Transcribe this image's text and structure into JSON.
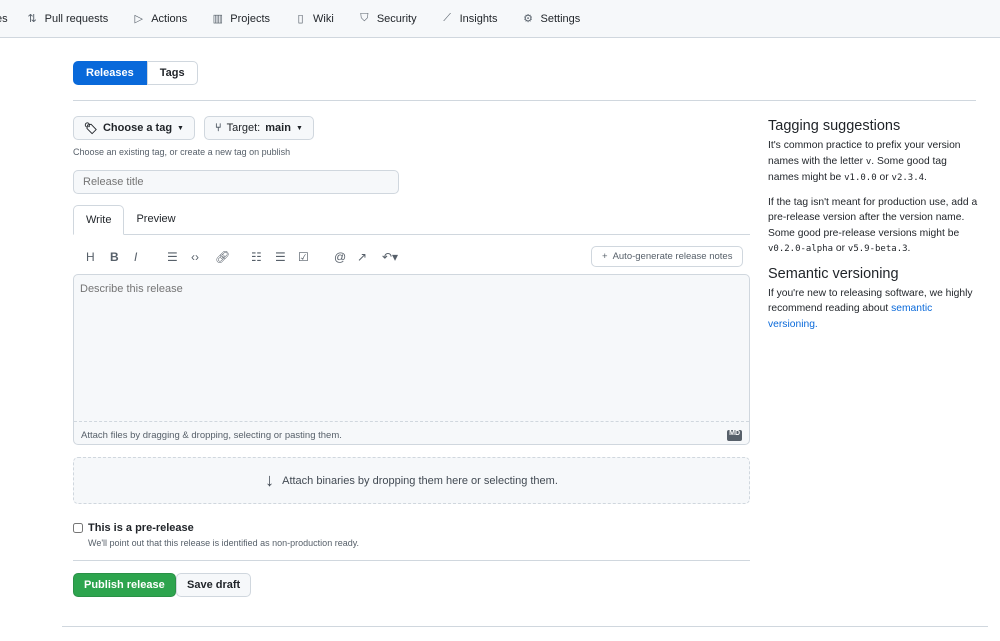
{
  "nav": [
    {
      "label": "es",
      "icon": ""
    },
    {
      "label": "Pull requests",
      "icon": "pull-request-icon"
    },
    {
      "label": "Actions",
      "icon": "play-icon"
    },
    {
      "label": "Projects",
      "icon": "project-icon"
    },
    {
      "label": "Wiki",
      "icon": "book-icon"
    },
    {
      "label": "Security",
      "icon": "shield-icon"
    },
    {
      "label": "Insights",
      "icon": "graph-icon"
    },
    {
      "label": "Settings",
      "icon": "gear-icon"
    }
  ],
  "seg": {
    "releases": "Releases",
    "tags": "Tags"
  },
  "form": {
    "choose_tag": "Choose a tag",
    "target_label": "Target:",
    "target_value": "main",
    "tag_hint": "Choose an existing tag, or create a new tag on publish",
    "title_placeholder": "Release title",
    "tab_write": "Write",
    "tab_preview": "Preview",
    "auto_generate": "Auto-generate release notes",
    "body_placeholder": "Describe this release",
    "attach_files": "Attach files by dragging & dropping, selecting or pasting them.",
    "markdown_badge": "MD",
    "attach_binaries": "Attach binaries by dropping them here or selecting them.",
    "prerelease_label": "This is a pre-release",
    "prerelease_hint": "We'll point out that this release is identified as non-production ready.",
    "publish": "Publish release",
    "save_draft": "Save draft"
  },
  "side": {
    "h1": "Tagging suggestions",
    "p1a": "It's common practice to prefix your version names with the letter ",
    "p1code1": "v",
    "p1b": ". Some good tag names might be ",
    "p1code2": "v1.0.0",
    "p1c": " or ",
    "p1code3": "v2.3.4",
    "p1d": ".",
    "p2a": "If the tag isn't meant for production use, add a pre-release version after the version name. Some good pre-release versions might be ",
    "p2code1": "v0.2.0-alpha",
    "p2b": " or ",
    "p2code2": "v5.9-beta.3",
    "p2c": ".",
    "h2": "Semantic versioning",
    "p3": "If you're new to releasing software, we highly recommend reading about ",
    "p3link": "semantic versioning."
  }
}
